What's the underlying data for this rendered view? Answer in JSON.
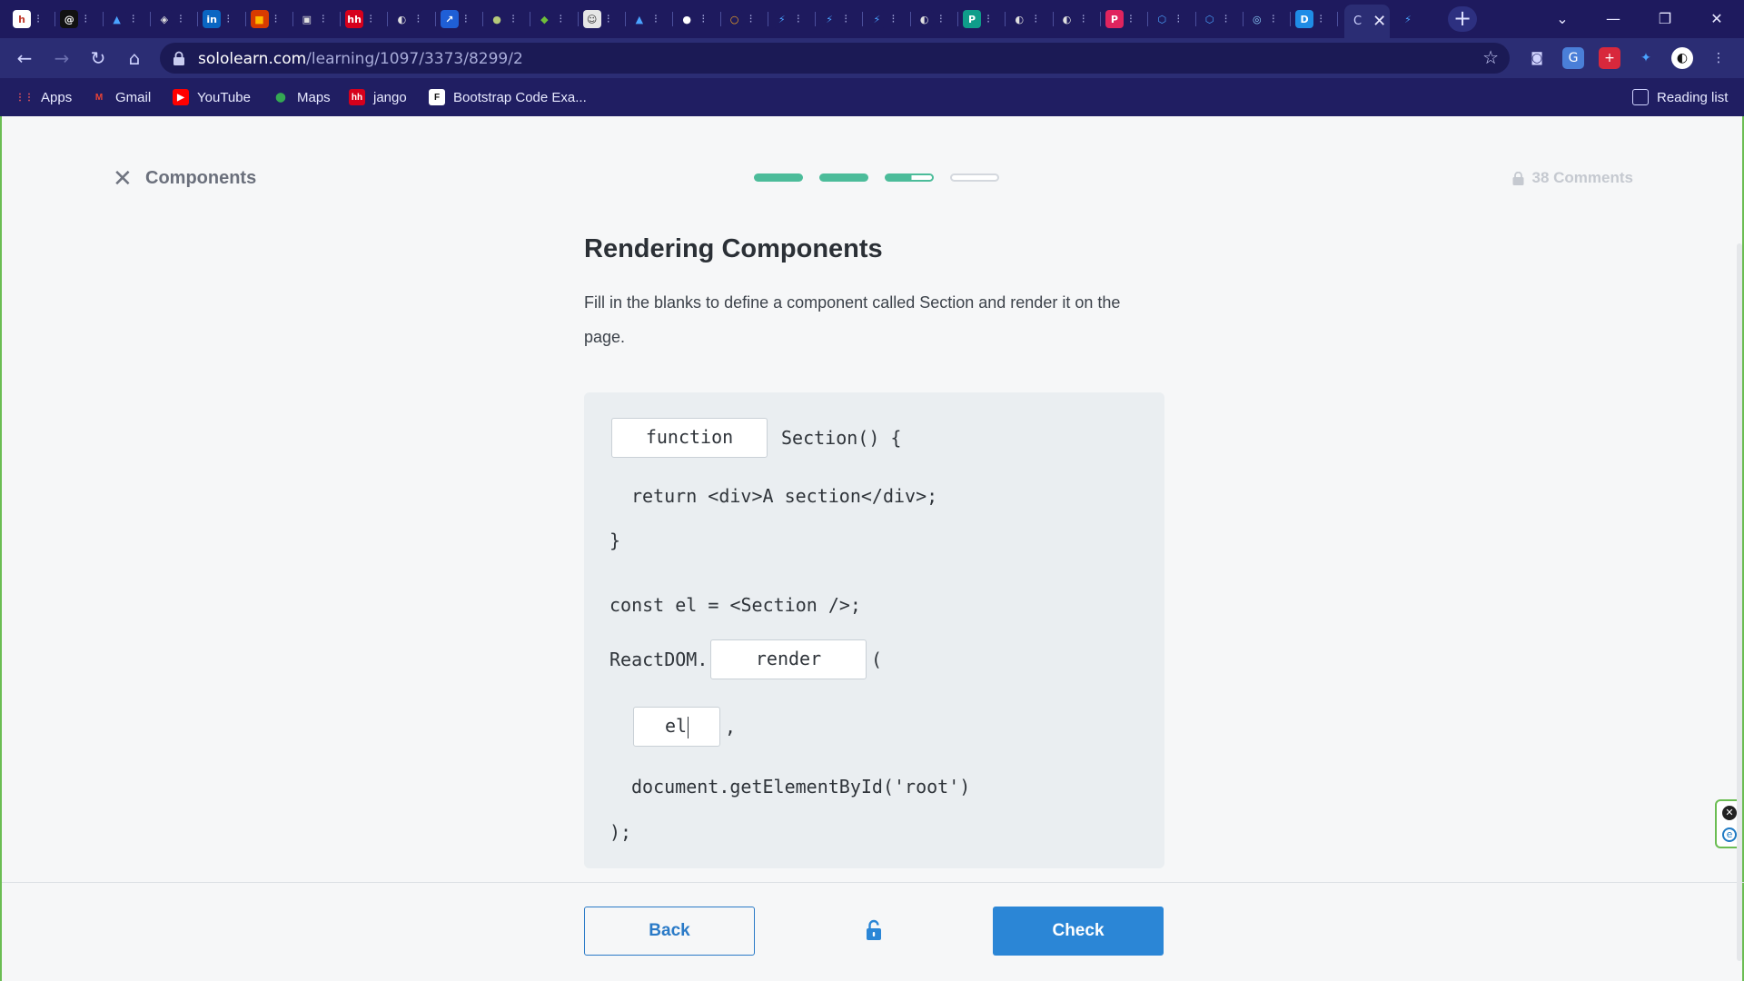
{
  "browser": {
    "tabs": [
      {
        "icon": "hh-icon",
        "glyph": "h",
        "color": "#ffffff",
        "text_color": "#c0392b"
      },
      {
        "icon": "at-icon",
        "glyph": "@",
        "color": "#111111",
        "text_color": "#ffffff"
      },
      {
        "icon": "triangle-icon",
        "glyph": "▲",
        "color": "#1e1a5e",
        "text_color": "#4aa3ff"
      },
      {
        "icon": "shield-icon",
        "glyph": "◈",
        "color": "#1e1a5e",
        "text_color": "#e0e0e0"
      },
      {
        "icon": "linkedin-icon",
        "glyph": "in",
        "color": "#0a66c2",
        "text_color": "#ffffff"
      },
      {
        "icon": "office-icon",
        "glyph": "■",
        "color": "#d83b01",
        "text_color": "#ffb900"
      },
      {
        "icon": "monitor-icon",
        "glyph": "▣",
        "color": "#1e1a5e",
        "text_color": "#e0e0e0"
      },
      {
        "icon": "hh-icon",
        "glyph": "hh",
        "color": "#d6001c",
        "text_color": "#ffffff"
      },
      {
        "icon": "globe-icon",
        "glyph": "◐",
        "color": "#1e1a5e",
        "text_color": "#e0e0e0"
      },
      {
        "icon": "arrow-icon",
        "glyph": "↗",
        "color": "#1f5fd6",
        "text_color": "#ffffff"
      },
      {
        "icon": "ball-icon",
        "glyph": "●",
        "color": "#1e1a5e",
        "text_color": "#b5c97a"
      },
      {
        "icon": "cube-icon",
        "glyph": "◆",
        "color": "#1e1a5e",
        "text_color": "#6fbf3a"
      },
      {
        "icon": "avatar-icon",
        "glyph": "☺",
        "color": "#e6e6e6",
        "text_color": "#333333"
      },
      {
        "icon": "peak-icon",
        "glyph": "▲",
        "color": "#1e1a5e",
        "text_color": "#4aa3ff"
      },
      {
        "icon": "github-icon",
        "glyph": "●",
        "color": "#1e1a5e",
        "text_color": "#ffffff"
      },
      {
        "icon": "circle-icon",
        "glyph": "○",
        "color": "#1e1a5e",
        "text_color": "#f5a623"
      },
      {
        "icon": "power-apps-icon",
        "glyph": "⚡",
        "color": "#1e1a5e",
        "text_color": "#4aa3ff"
      },
      {
        "icon": "power-apps-icon",
        "glyph": "⚡",
        "color": "#1e1a5e",
        "text_color": "#4aa3ff"
      },
      {
        "icon": "power-apps-icon",
        "glyph": "⚡",
        "color": "#1e1a5e",
        "text_color": "#4aa3ff"
      },
      {
        "icon": "globe-icon",
        "glyph": "◐",
        "color": "#1e1a5e",
        "text_color": "#e0e0e0"
      },
      {
        "icon": "p-icon",
        "glyph": "P",
        "color": "#0f9d8a",
        "text_color": "#ffffff"
      },
      {
        "icon": "globe-icon",
        "glyph": "◐",
        "color": "#1e1a5e",
        "text_color": "#e0e0e0"
      },
      {
        "icon": "globe-icon",
        "glyph": "◐",
        "color": "#1e1a5e",
        "text_color": "#e0e0e0"
      },
      {
        "icon": "p-icon",
        "glyph": "P",
        "color": "#e0245e",
        "text_color": "#ffffff"
      },
      {
        "icon": "hexagon-icon",
        "glyph": "⬡",
        "color": "#1e1a5e",
        "text_color": "#4aa3ff"
      },
      {
        "icon": "hexagon-icon",
        "glyph": "⬡",
        "color": "#1e1a5e",
        "text_color": "#4aa3ff"
      },
      {
        "icon": "ring-icon",
        "glyph": "◎",
        "color": "#1e1a5e",
        "text_color": "#8fd3ff"
      },
      {
        "icon": "d-icon",
        "glyph": "D",
        "color": "#1f8ce6",
        "text_color": "#ffffff"
      }
    ],
    "active_tab_glyph": "C",
    "last_tab_glyph": "⚡",
    "new_tab": "+",
    "window": {
      "dropdown": "⌄",
      "minimize": "—",
      "restore": "❐",
      "close": "✕"
    },
    "url": {
      "host": "sololearn.com",
      "path": "/learning/1097/3373/8299/2"
    },
    "bookmarks": [
      {
        "label": "Apps",
        "icon": "apps-grid-icon",
        "glyph": "⋮⋮",
        "color": "#201e62",
        "text_color": "#ff5a5a"
      },
      {
        "label": "Gmail",
        "icon": "gmail-icon",
        "glyph": "M",
        "color": "#201e62",
        "text_color": "#ea4335"
      },
      {
        "label": "YouTube",
        "icon": "youtube-icon",
        "glyph": "▶",
        "color": "#ff0000",
        "text_color": "#ffffff"
      },
      {
        "label": "Maps",
        "icon": "maps-pin-icon",
        "glyph": "⬤",
        "color": "#201e62",
        "text_color": "#34a853"
      },
      {
        "label": "jango",
        "icon": "hh-icon",
        "glyph": "hh",
        "color": "#d6001c",
        "text_color": "#ffffff"
      },
      {
        "label": "Bootstrap Code Exa...",
        "icon": "bootstrap-icon",
        "glyph": "F",
        "color": "#ffffff",
        "text_color": "#111111"
      }
    ],
    "reading_list": "Reading list"
  },
  "lesson": {
    "module": "Components",
    "comments": "38 Comments",
    "progress": [
      {
        "state": "complete",
        "fill": 1.0
      },
      {
        "state": "complete",
        "fill": 1.0
      },
      {
        "state": "current",
        "fill": 0.55
      },
      {
        "state": "pending",
        "fill": 0.0
      }
    ],
    "title": "Rendering Components",
    "instructions": "Fill in the blanks to define a component called Section and render it on the page.",
    "code": {
      "blank1": "function",
      "line1_rest": "Section() {",
      "line2": "return <div>A section</div>;",
      "line3": "}",
      "line4": "const el = <Section />;",
      "line5_prefix": "ReactDOM.",
      "blank2": "render",
      "line5_suffix": "(",
      "blank3": "el",
      "line6_suffix": ",",
      "line7": "document.getElementById('root')",
      "line8": ");"
    },
    "buttons": {
      "back": "Back",
      "check": "Check"
    }
  },
  "colors": {
    "accent_green": "#4cbc9a",
    "primary_blue": "#2b86d6",
    "browser_frame": "#1e1a5e"
  }
}
